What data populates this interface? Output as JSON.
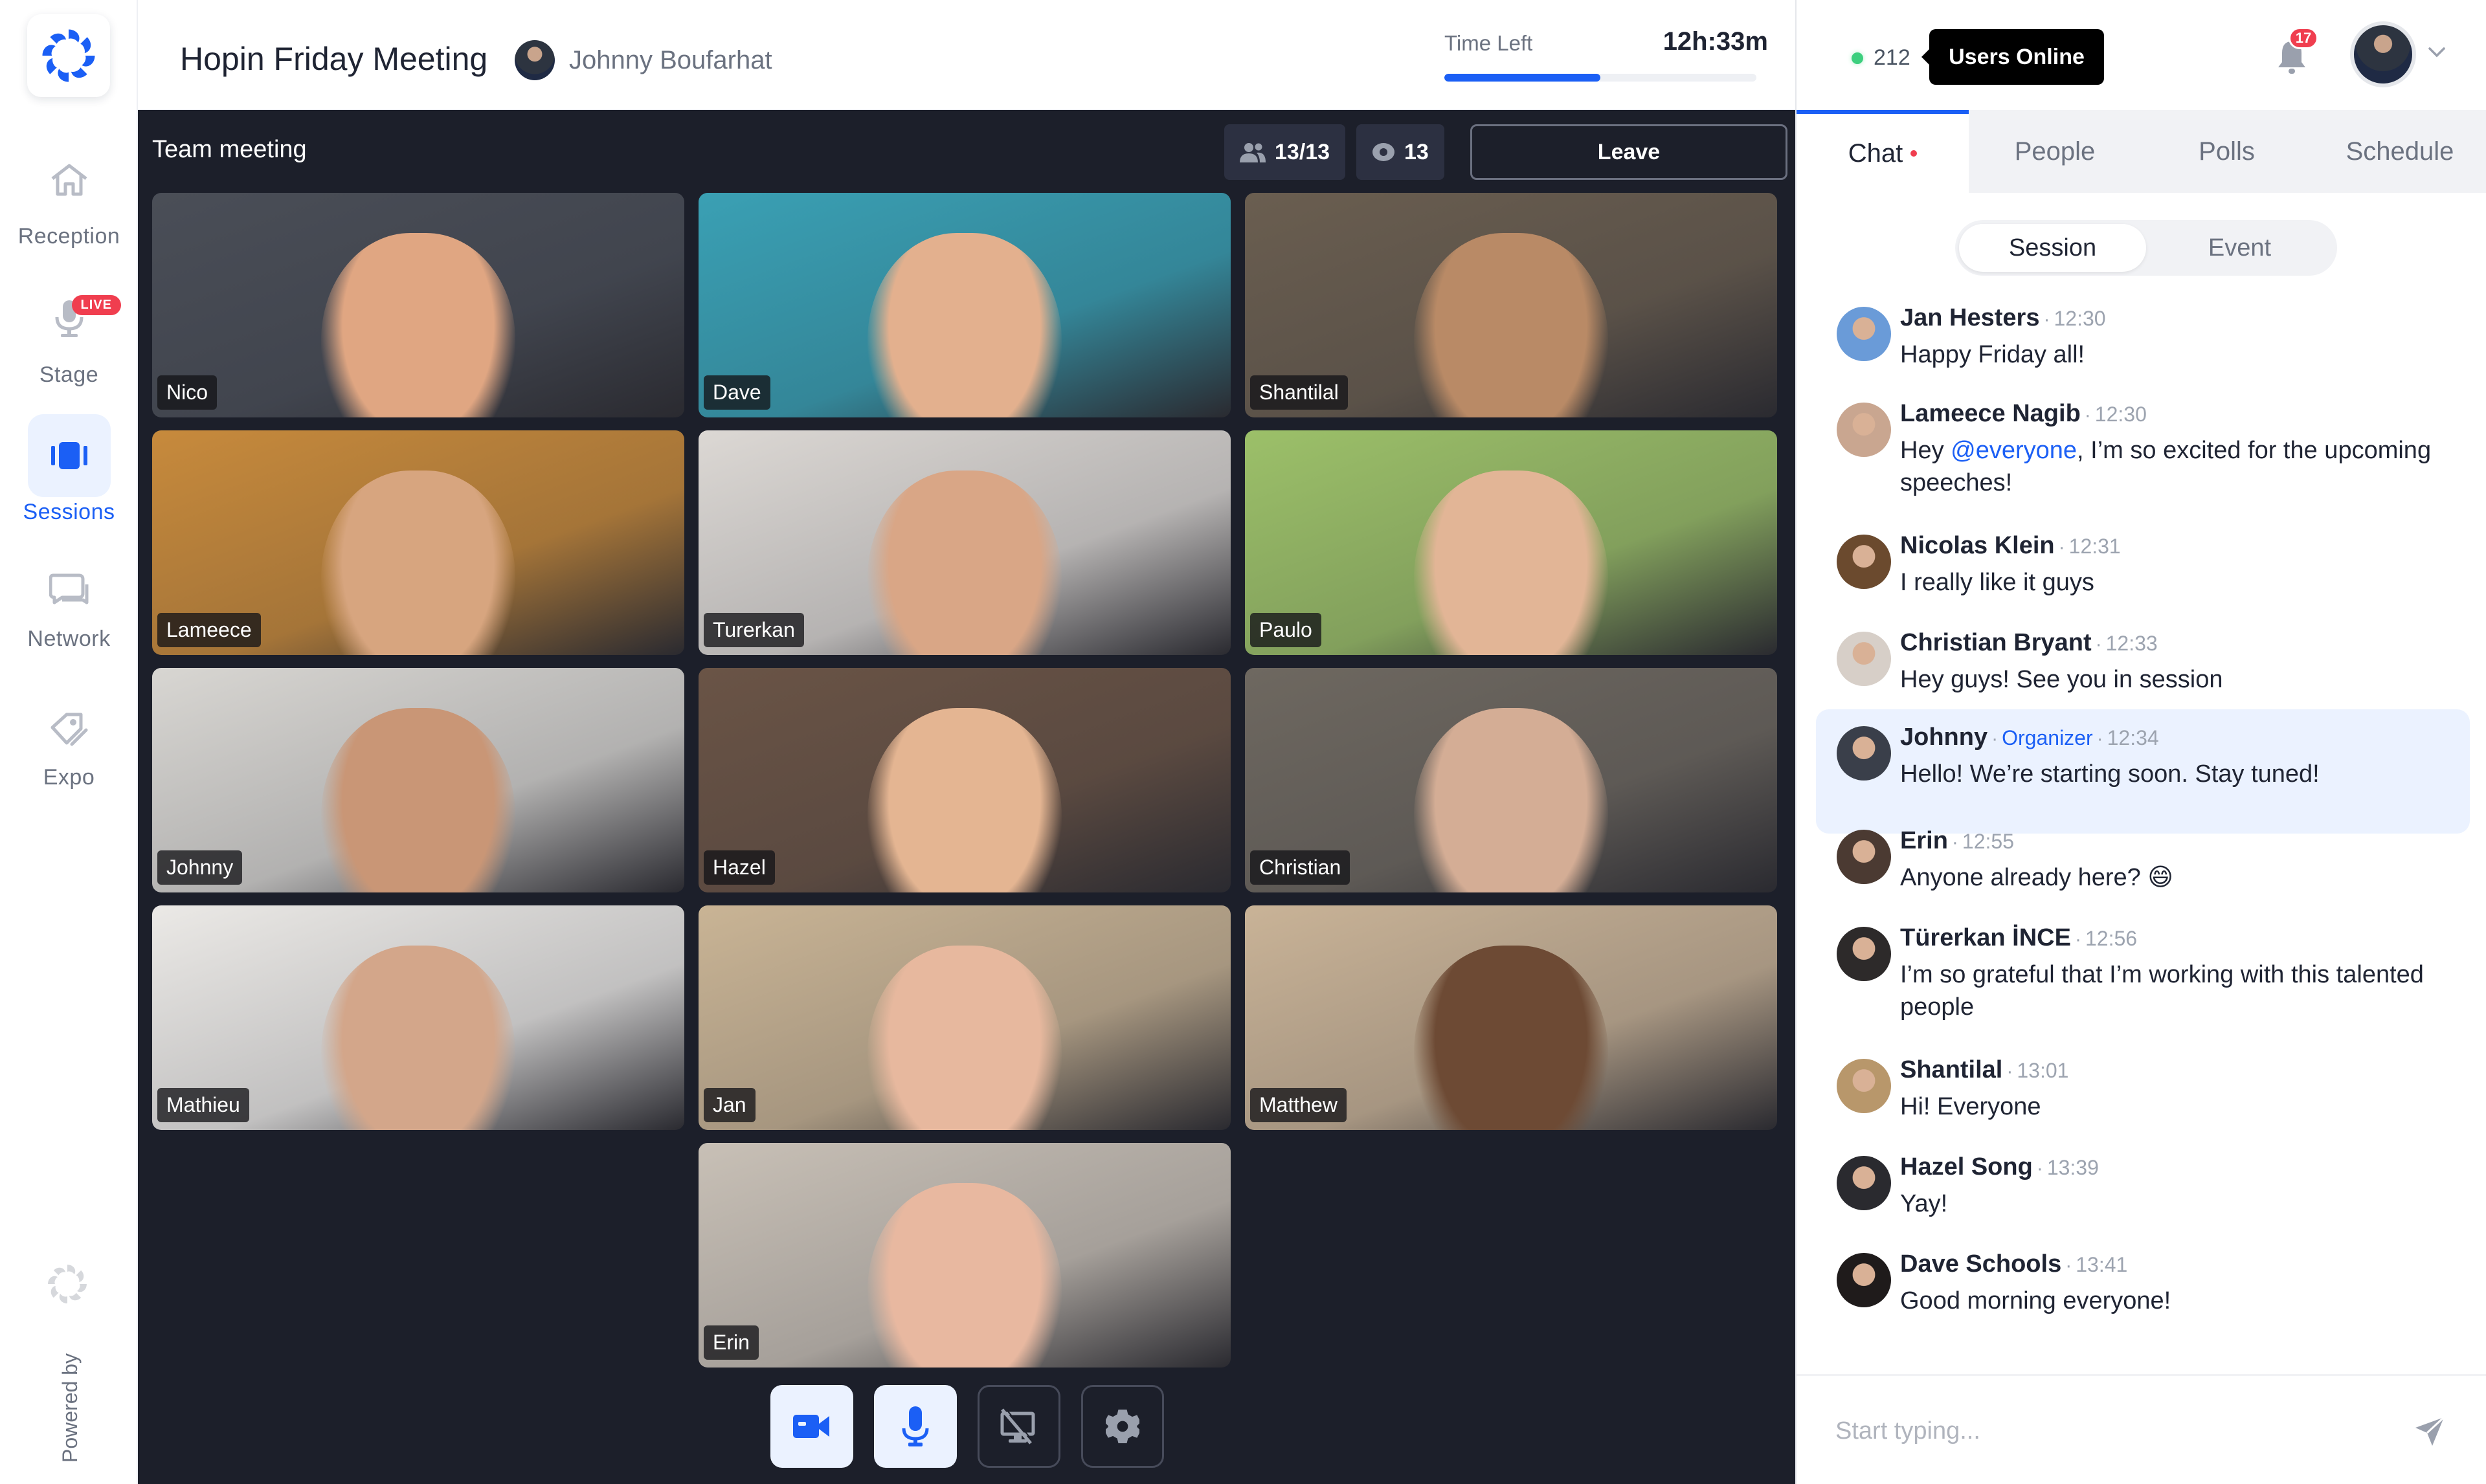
{
  "header": {
    "title": "Hopin Friday Meeting",
    "host_name": "Johnny Boufarhat",
    "time_left_label": "Time Left",
    "time_left_value": "12h:33m",
    "time_progress_percent": 50
  },
  "sidebar": {
    "items": [
      {
        "label": "Reception",
        "icon": "home-icon",
        "active": false
      },
      {
        "label": "Stage",
        "icon": "microphone-icon",
        "active": false,
        "badge": "LIVE"
      },
      {
        "label": "Sessions",
        "icon": "sessions-icon",
        "active": true
      },
      {
        "label": "Network",
        "icon": "chat-bubbles-icon",
        "active": false
      },
      {
        "label": "Expo",
        "icon": "tag-icon",
        "active": false
      }
    ],
    "powered_by": "Powered by"
  },
  "stage": {
    "title": "Team meeting",
    "participants": "13/13",
    "viewers": "13",
    "leave_label": "Leave",
    "tiles": [
      {
        "name": "Nico"
      },
      {
        "name": "Dave"
      },
      {
        "name": "Shantilal"
      },
      {
        "name": "Lameece"
      },
      {
        "name": "Turerkan"
      },
      {
        "name": "Paulo"
      },
      {
        "name": "Johnny"
      },
      {
        "name": "Hazel"
      },
      {
        "name": "Christian"
      },
      {
        "name": "Mathieu"
      },
      {
        "name": "Jan"
      },
      {
        "name": "Matthew"
      },
      {
        "name": "Erin"
      }
    ],
    "controls": [
      {
        "name": "camera",
        "icon": "video-camera-icon",
        "state": "on"
      },
      {
        "name": "microphone",
        "icon": "microphone-icon",
        "state": "on"
      },
      {
        "name": "screen-share",
        "icon": "screen-share-off-icon",
        "state": "off"
      },
      {
        "name": "settings",
        "icon": "gear-icon",
        "state": "off"
      }
    ]
  },
  "panel": {
    "online_count": "212",
    "tooltip": "Users Online",
    "notifications": "17",
    "tabs": [
      {
        "label": "Chat",
        "active": true,
        "unread": true
      },
      {
        "label": "People",
        "active": false
      },
      {
        "label": "Polls",
        "active": false
      },
      {
        "label": "Schedule",
        "active": false
      }
    ],
    "segments": [
      {
        "label": "Session",
        "active": true
      },
      {
        "label": "Event",
        "active": false
      }
    ],
    "messages": [
      {
        "author": "Jan Hesters",
        "time": "12:30",
        "text": "Happy Friday all!"
      },
      {
        "author": "Lameece Nagib",
        "time": "12:30",
        "text_before": "Hey ",
        "mention": "@everyone",
        "text_after": ", I’m so excited for the upcoming speeches!"
      },
      {
        "author": "Nicolas Klein",
        "time": "12:31",
        "text": "I really like it guys"
      },
      {
        "author": "Christian Bryant",
        "time": "12:33",
        "text": "Hey guys! See you in session"
      },
      {
        "author": "Johnny",
        "role": "Organizer",
        "time": "12:34",
        "text": "Hello! We’re starting soon. Stay tuned!",
        "highlight": true
      },
      {
        "author": "Erin",
        "time": "12:55",
        "text": "Anyone already here? 😄"
      },
      {
        "author": "Türerkan İNCE",
        "time": "12:56",
        "text": "I’m so grateful that I’m working with this talented people"
      },
      {
        "author": "Shantilal",
        "time": "13:01",
        "text": "Hi! Everyone"
      },
      {
        "author": "Hazel Song",
        "time": "13:39",
        "text": "Yay!"
      },
      {
        "author": "Dave Schools",
        "time": "13:41",
        "text": "Good morning everyone!"
      }
    ],
    "composer_placeholder": "Start typing..."
  },
  "colors": {
    "accent": "#1b5ff5",
    "stage_bg": "#1c1f2a",
    "live_red": "#f03e4f",
    "online_green": "#3ccf7e",
    "highlight_bg": "#ebf2ff"
  }
}
